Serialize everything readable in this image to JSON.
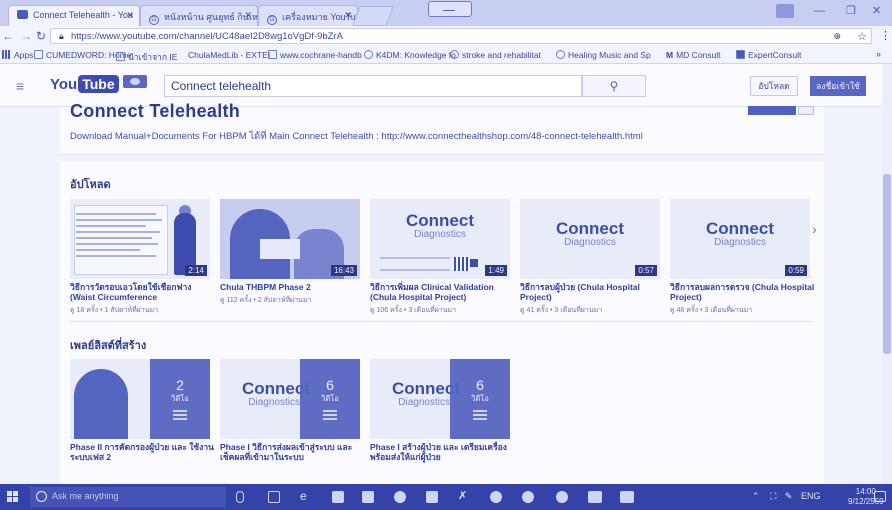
{
  "browser": {
    "tabs": [
      {
        "label": "Connect Telehealth - You",
        "active": true
      },
      {
        "label": "หนังหน้าน ศูนยุทธ์ กินเหล่า",
        "active": false
      },
      {
        "label": "เครื่องหมาย YouTube - ค้น",
        "active": false
      }
    ],
    "url": "https://www.youtube.com/channel/UC48aeI2D8wg1oVgDf-9bZrA",
    "bookmarks": [
      "Apps",
      "CUMEDWORD: Home",
      "นำเข้าจาก IE",
      "ChulaMedLib - EXTEI",
      "www.cochrane-handb",
      "K4DM: Knowledge fo",
      "stroke and rehabilitat",
      "Healing Music and Sp",
      "MD Consult",
      "ExpertConsult"
    ],
    "bookmarks_more": "»"
  },
  "youtube": {
    "logo_left": "You",
    "logo_right": "Tube",
    "search_value": "Connect telehealth",
    "upload_label": "อัปโหลด",
    "signin_label": "ลงชื่อเข้าใช้",
    "channel_title": "Connect Telehealth",
    "description": "Download Manual+Documents For HBPM ได้ที่ Main Connect Telehealth : http://www.connecthealthshop.com/48-connect-telehealth.html",
    "uploads_title": "อัปโหลด",
    "playlists_title": "เพลย์ลิสต์ที่สร้าง",
    "uploads": [
      {
        "title": "วิธีการวัดรอบเอวโดยใช้เชือกฟาง (Waist Circumference",
        "meta": "ดู 18 ครั้ง • 1 สัปดาห์ที่ผ่านมา",
        "duration": "2:14",
        "thumb": "doc"
      },
      {
        "title": "Chula THBPM Phase 2",
        "meta": "ดู 112 ครั้ง • 2 สัปดาห์ที่ผ่านมา",
        "duration": "16:43",
        "thumb": "photo"
      },
      {
        "title": "วิธีการเพิ่มผล Clinical Validation (Chula Hospital Project)",
        "meta": "ดู 106 ครั้ง • 3 เดือนที่ผ่านมา",
        "duration": "1:49",
        "thumb": "connect-doc"
      },
      {
        "title": "วิธีการลบผู้ป่วย (Chula Hospital Project)",
        "meta": "ดู 41 ครั้ง • 3 เดือนที่ผ่านมา",
        "duration": "0:57",
        "thumb": "connect"
      },
      {
        "title": "วิธีการลบผลการตรวจ (Chula Hospital Project)",
        "meta": "ดู 48 ครั้ง • 3 เดือนที่ผ่านมา",
        "duration": "0:59",
        "thumb": "connect"
      }
    ],
    "connect_logo": "Connect",
    "connect_sub": "Diagnostics",
    "playlists": [
      {
        "title": "Phase II การคัดกรองผู้ป่วย และ ใช้งานระบบเฟส 2",
        "count": "2",
        "count_label": "วิดีโอ",
        "thumb": "photo"
      },
      {
        "title": "Phase I วิธีการส่งผลเข้าสู่ระบบ และ เช็คผลที่เข้ามาในระบบ",
        "count": "6",
        "count_label": "วิดีโอ",
        "thumb": "connect"
      },
      {
        "title": "Phase I สร้างผู้ป่วย และ เตรียมเครื่องพร้อมส่งให้แก่ผู้ป่วย",
        "count": "6",
        "count_label": "วิดีโอ",
        "thumb": "connect"
      }
    ]
  },
  "taskbar": {
    "search_placeholder": "Ask me anything",
    "language": "ENG",
    "time": "14:00",
    "date": "9/12/2559"
  },
  "colors": {
    "tint": "#3543a8",
    "accent": "#5867c4"
  }
}
